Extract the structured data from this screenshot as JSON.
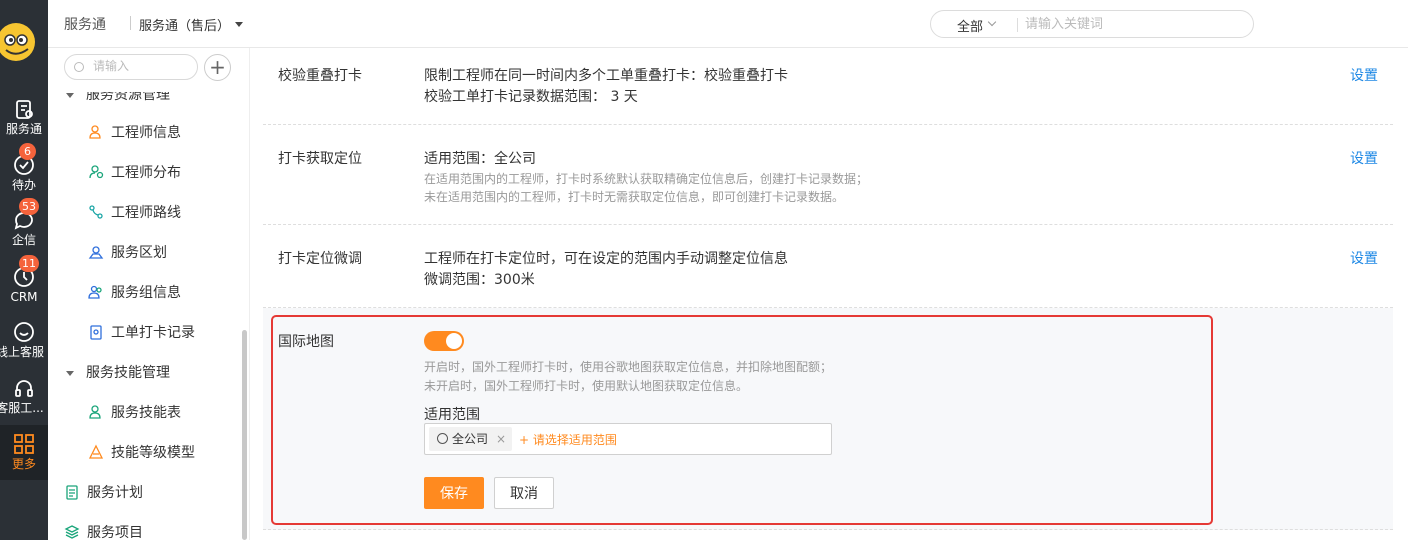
{
  "rail": {
    "items": [
      {
        "label": "服务通",
        "icon": "clipboard-wrench-icon",
        "badge": ""
      },
      {
        "label": "待办",
        "icon": "check-circle-icon",
        "badge": "6"
      },
      {
        "label": "企信",
        "icon": "chat-bubble-icon",
        "badge": "53"
      },
      {
        "label": "CRM",
        "icon": "clock-icon",
        "badge": "11"
      },
      {
        "label": "线上客服",
        "icon": "smile-chat-icon",
        "badge": ""
      },
      {
        "label": "客服工...",
        "icon": "headset-icon",
        "badge": ""
      },
      {
        "label": "更多",
        "icon": "grid-icon",
        "badge": ""
      }
    ]
  },
  "topbar": {
    "app_name": "服务通",
    "scope": "服务通（售后）",
    "search_category": "全部",
    "search_placeholder": "请输入关键词"
  },
  "sidebar": {
    "search_placeholder": "请输入",
    "group1_title": "服务资源管理",
    "group1_items": [
      {
        "label": "工程师信息",
        "icon": "engineer-icon"
      },
      {
        "label": "工程师分布",
        "icon": "location-pin-icon"
      },
      {
        "label": "工程师路线",
        "icon": "route-icon"
      },
      {
        "label": "服务区划",
        "icon": "area-icon"
      },
      {
        "label": "服务组信息",
        "icon": "group-icon"
      },
      {
        "label": "工单打卡记录",
        "icon": "checkin-record-icon"
      }
    ],
    "group2_title": "服务技能管理",
    "group2_items": [
      {
        "label": "服务技能表",
        "icon": "skill-icon"
      },
      {
        "label": "技能等级模型",
        "icon": "triangle-level-icon"
      }
    ],
    "plan_label": "服务计划",
    "project_label": "服务项目"
  },
  "settings": [
    {
      "title": "校验重叠打卡",
      "line1": "限制工程师在同一时间内多个工单重叠打卡：校验重叠打卡",
      "line2": "校验工单打卡记录数据范围： 3 天",
      "action": "设置"
    },
    {
      "title": "打卡获取定位",
      "line1": "适用范围：全公司",
      "note1": "在适用范围内的工程师，打卡时系统默认获取精确定位信息后，创建打卡记录数据；",
      "note2": "未在适用范围内的工程师，打卡时无需获取定位信息，即可创建打卡记录数据。",
      "action": "设置"
    },
    {
      "title": "打卡定位微调",
      "line1": "工程师在打卡定位时，可在设定的范围内手动调整定位信息",
      "line2": "微调范围：300米",
      "action": "设置"
    }
  ],
  "intl_map": {
    "title": "国际地图",
    "enabled": true,
    "note1": "开启时，国外工程师打卡时，使用谷歌地图获取定位信息，并扣除地图配额；",
    "note2": "未开启时，国外工程师打卡时，使用默认地图获取定位信息。",
    "scope_label": "适用范围",
    "scope_tag": "全公司",
    "add_scope": "+ 请选择适用范围",
    "save": "保存",
    "cancel": "取消"
  },
  "colors": {
    "accent": "#ff8a1f",
    "link": "#1e88e5",
    "highlight": "#e53935",
    "badge": "#f5633c"
  }
}
